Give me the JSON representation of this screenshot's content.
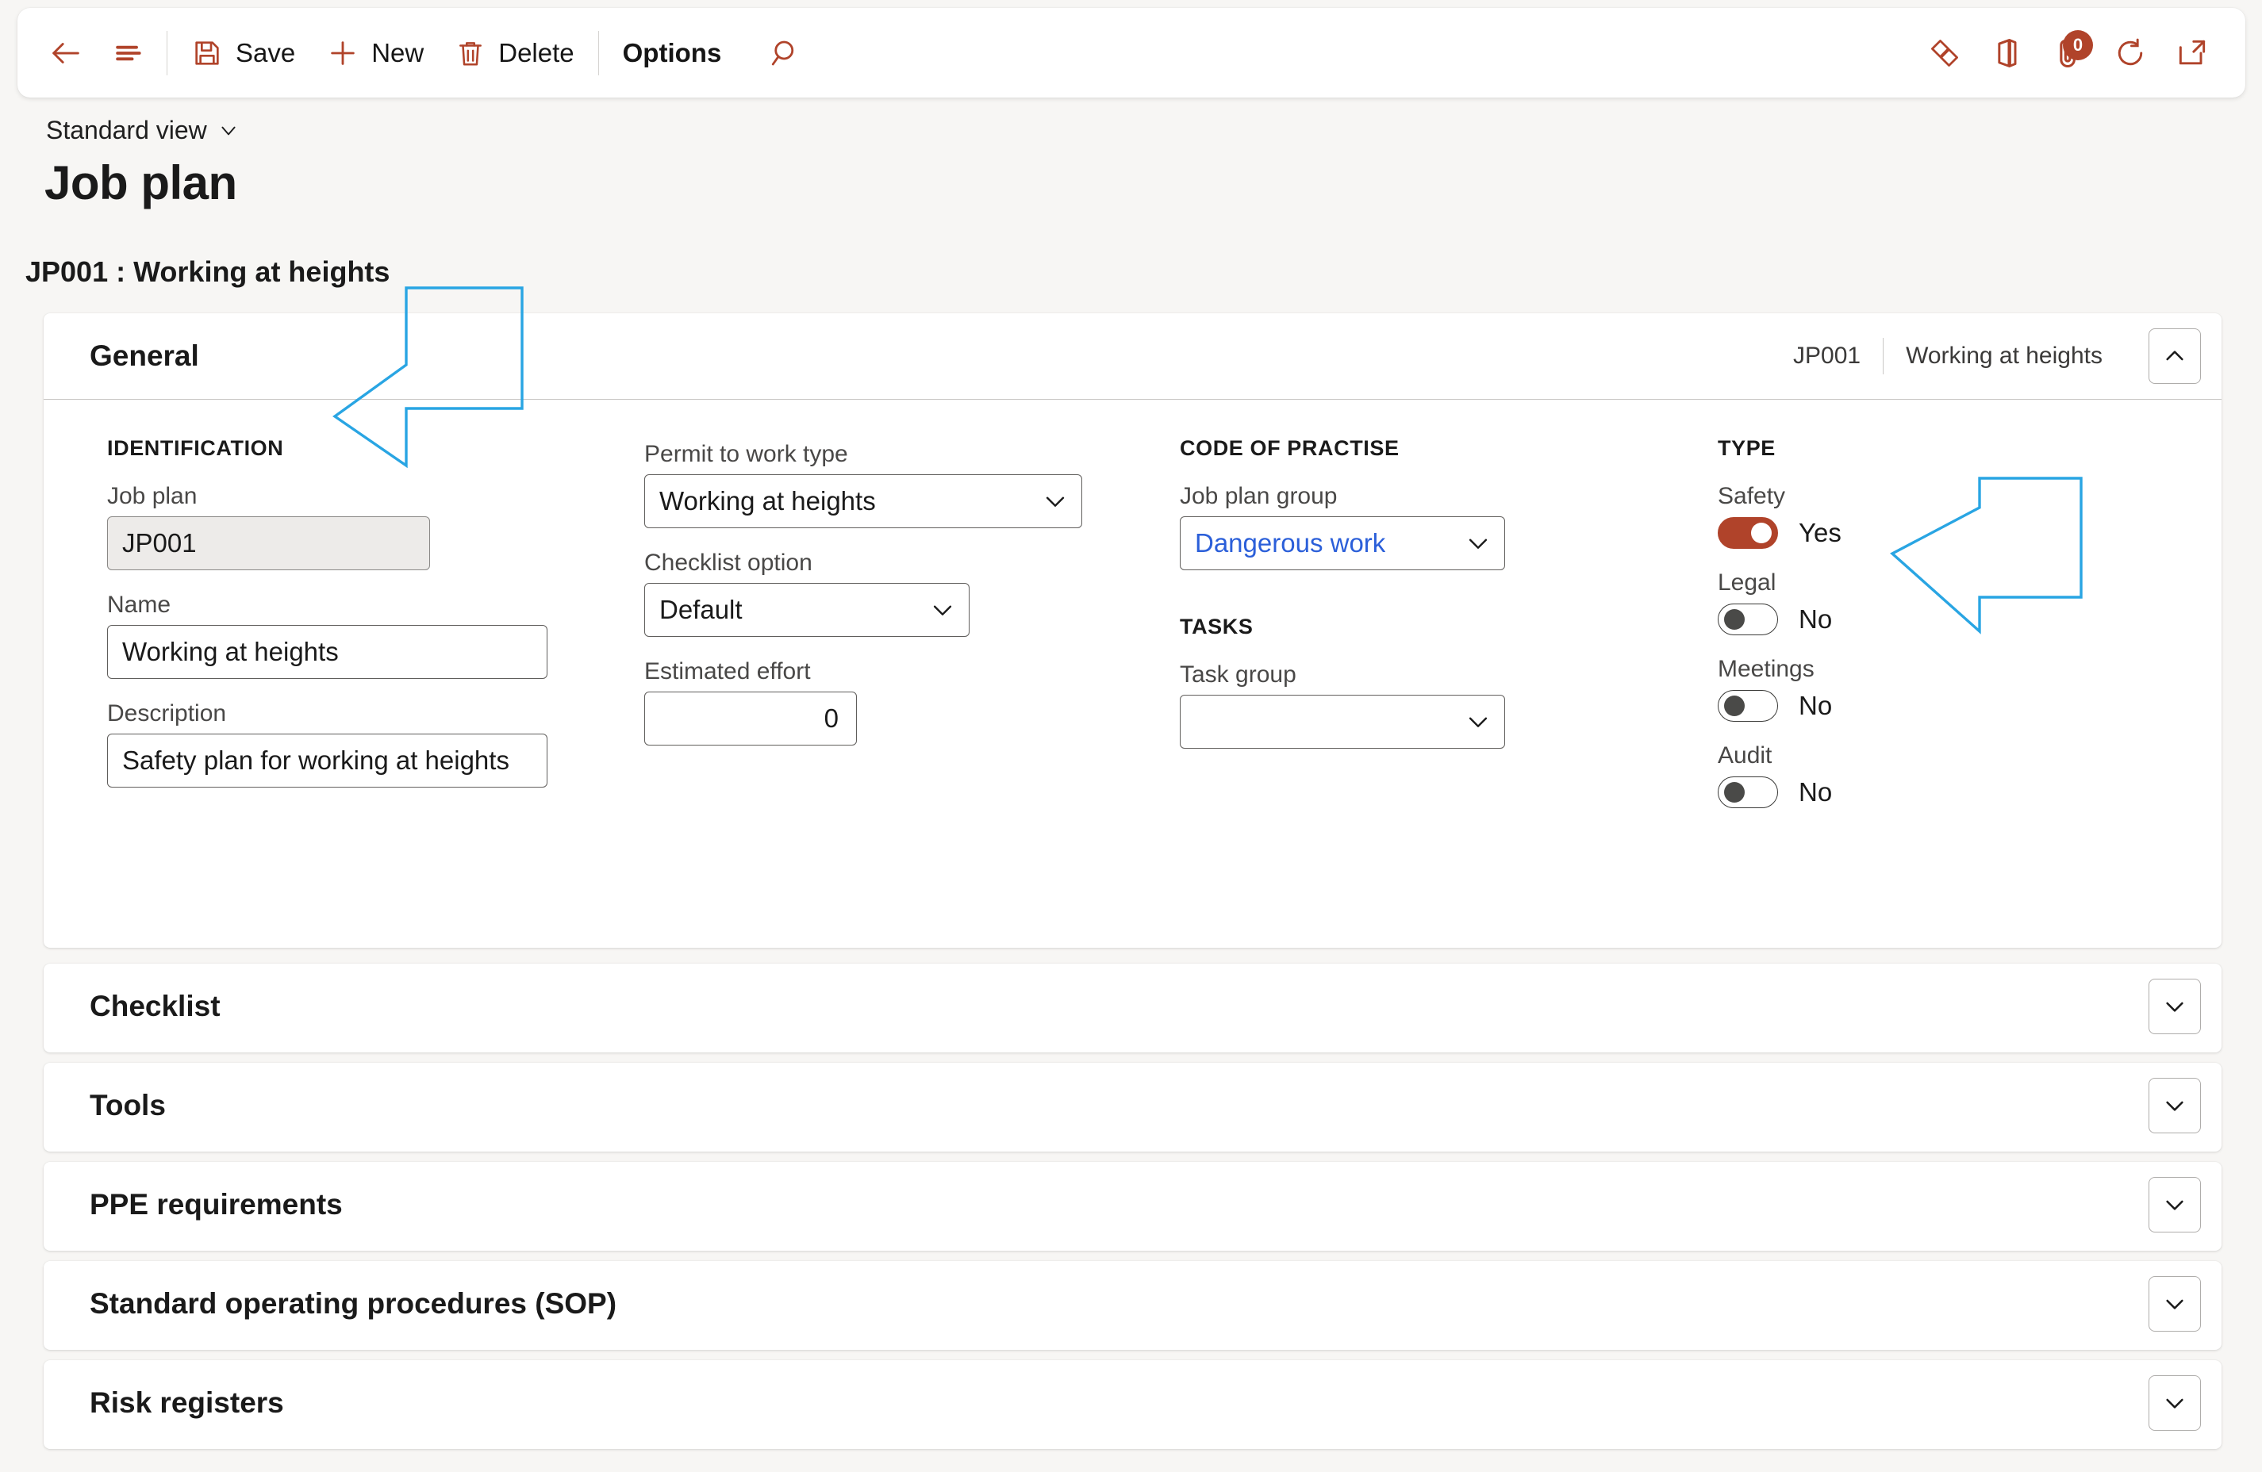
{
  "commandbar": {
    "back_label": "Back",
    "showlist_label": "Show list",
    "save_label": "Save",
    "new_label": "New",
    "delete_label": "Delete",
    "options_label": "Options",
    "search_label": "Search",
    "powerapps_label": "Power Apps",
    "office_label": "Open in Microsoft Office",
    "attachments_label": "Attachments",
    "attachments_count": "0",
    "refresh_label": "Refresh",
    "popout_label": "Open in new window",
    "accent_color": "#B0432A"
  },
  "header": {
    "view_selector": "Standard view",
    "page_title": "Job plan",
    "record_caption": "JP001 : Working at heights"
  },
  "general": {
    "title": "General",
    "summary_id": "JP001",
    "summary_name": "Working at heights",
    "identification": {
      "group_title": "IDENTIFICATION",
      "job_plan_label": "Job plan",
      "job_plan_value": "JP001",
      "name_label": "Name",
      "name_value": "Working at heights",
      "description_label": "Description",
      "description_value": "Safety plan for working at heights"
    },
    "work": {
      "permit_label": "Permit to work type",
      "permit_value": "Working at heights",
      "checklist_label": "Checklist option",
      "checklist_value": "Default",
      "effort_label": "Estimated effort",
      "effort_value": "0"
    },
    "code_of_practise": {
      "group_title": "CODE OF PRACTISE",
      "job_plan_group_label": "Job plan group",
      "job_plan_group_value": "Dangerous work",
      "job_plan_group_color": "#2B5FD9"
    },
    "tasks": {
      "group_title": "TASKS",
      "task_group_label": "Task group",
      "task_group_value": ""
    },
    "type": {
      "group_title": "TYPE",
      "toggles": [
        {
          "label": "Safety",
          "value": "Yes",
          "on": true
        },
        {
          "label": "Legal",
          "value": "No",
          "on": false
        },
        {
          "label": "Meetings",
          "value": "No",
          "on": false
        },
        {
          "label": "Audit",
          "value": "No",
          "on": false
        }
      ],
      "on_color": "#B0432A"
    }
  },
  "sections": [
    {
      "title": "Checklist"
    },
    {
      "title": "Tools"
    },
    {
      "title": "PPE requirements"
    },
    {
      "title": "Standard operating procedures (SOP)"
    },
    {
      "title": "Risk registers"
    }
  ],
  "annotations": {
    "arrow_color": "#29A5E3",
    "arrow_general_label": "arrow pointing to General section header",
    "arrow_safety_label": "arrow pointing to Safety toggle"
  }
}
